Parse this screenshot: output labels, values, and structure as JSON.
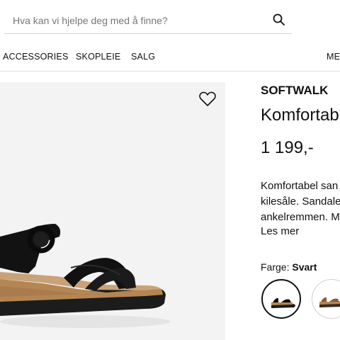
{
  "search": {
    "placeholder": "Hva kan vi hjelpe deg med å finne?"
  },
  "nav": {
    "items": [
      "ACCESSORIES",
      "SKOPLEIE",
      "SALG",
      "ME"
    ]
  },
  "product": {
    "brand": "SOFTWALK",
    "title": "Komfortabe",
    "price": "1 199,-",
    "description_lines": [
      "Komfortabel san",
      "kilesåle. Sandale",
      "ankelremmen. M"
    ],
    "read_more": "Les mer",
    "color_label": "Farge:",
    "color_value": "Svart"
  },
  "icons": {
    "search": "search-icon",
    "wishlist": "heart-icon"
  },
  "colors": {
    "text": "#111111",
    "image_bg": "#f3f3f3",
    "divider": "#e3e3e3"
  }
}
